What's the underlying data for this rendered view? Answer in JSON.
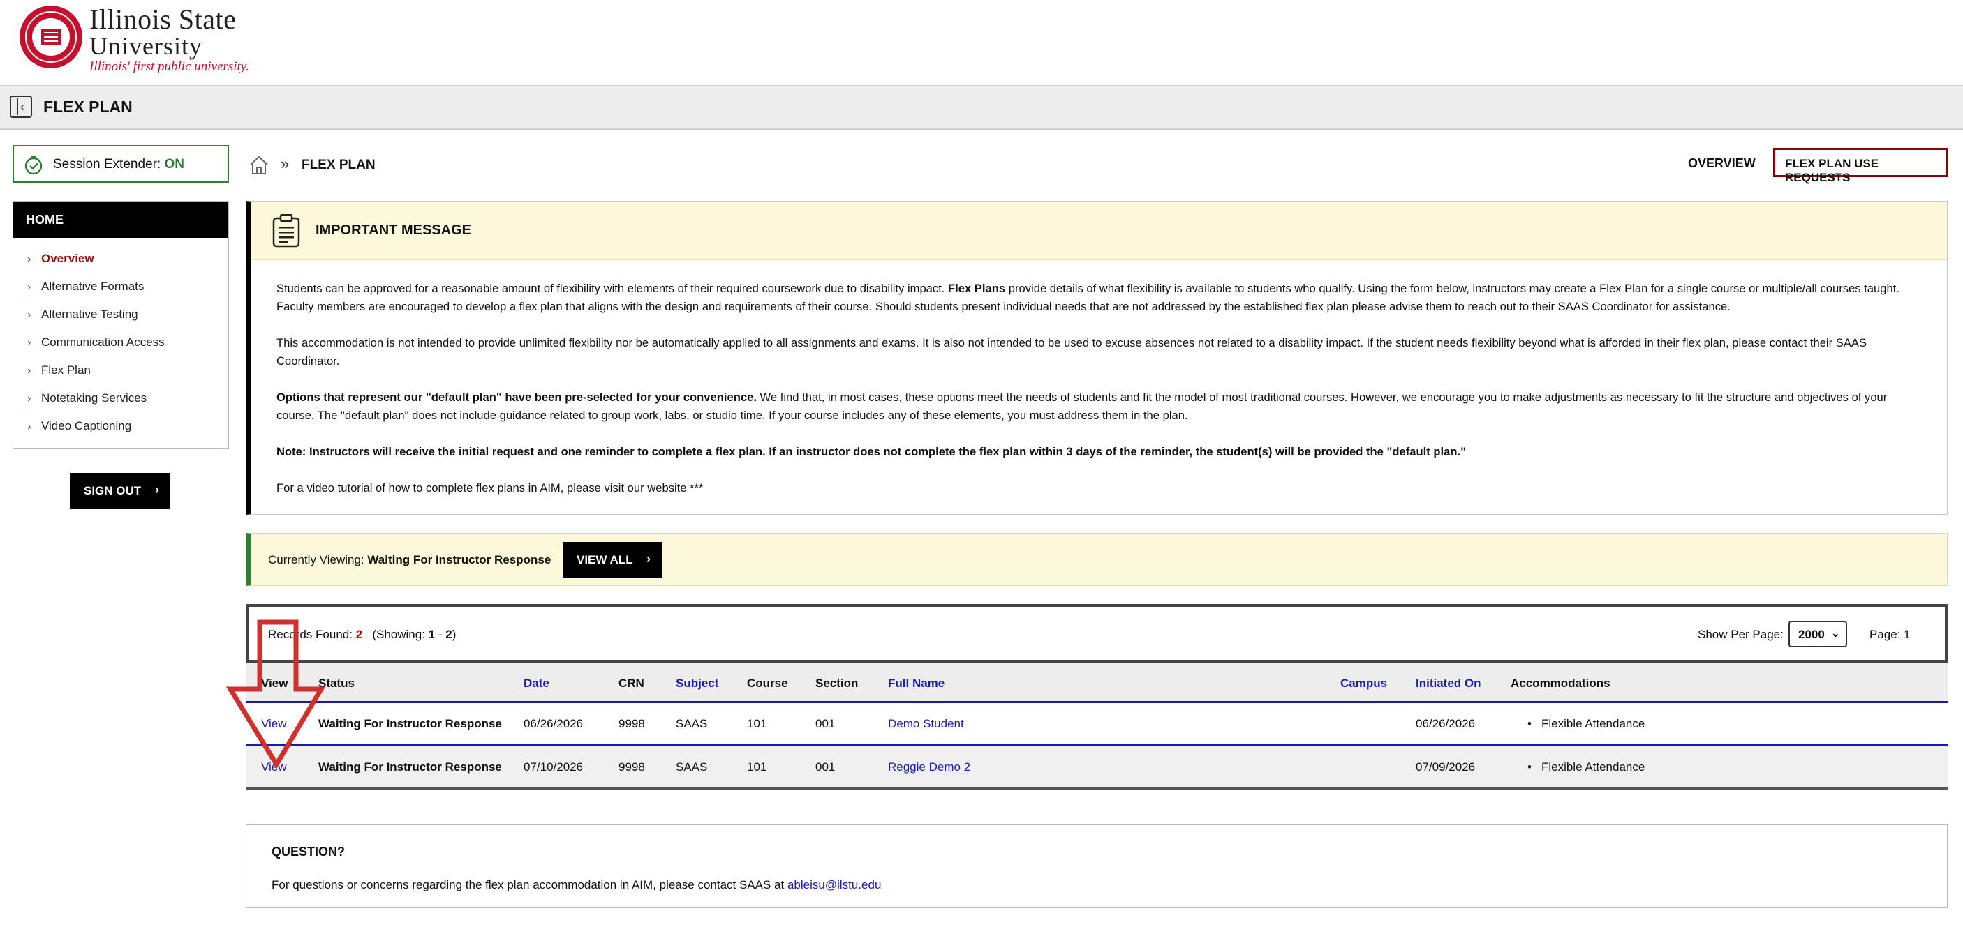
{
  "header": {
    "logo_line1": "Illinois State",
    "logo_line2": "University",
    "tagline": "Illinois' first public university."
  },
  "titlebar": {
    "title": "FLEX PLAN"
  },
  "session": {
    "label": "Session Extender:",
    "state": "ON"
  },
  "nav": {
    "heading": "HOME",
    "items": [
      {
        "label": "Overview"
      },
      {
        "label": "Alternative Formats"
      },
      {
        "label": "Alternative Testing"
      },
      {
        "label": "Communication Access"
      },
      {
        "label": "Flex Plan"
      },
      {
        "label": "Notetaking Services"
      },
      {
        "label": "Video Captioning"
      }
    ],
    "signout": "SIGN OUT"
  },
  "breadcrumb": {
    "current": "FLEX PLAN"
  },
  "top_links": {
    "overview": "OVERVIEW",
    "requests": "FLEX PLAN USE REQUESTS"
  },
  "message": {
    "title": "IMPORTANT MESSAGE",
    "p1_a": "Students can be approved for a reasonable amount of flexibility with elements of their required coursework due to disability impact. ",
    "p1_b": "Flex Plans",
    "p1_c": " provide details of what flexibility is available to students who qualify. Using the form below, instructors may create a Flex Plan for a single course or multiple/all courses taught. Faculty members are encouraged to develop a flex plan that aligns with the design and requirements of their course. Should students present individual needs that are not addressed by the established flex plan please advise them to reach out to their SAAS Coordinator for assistance.",
    "p2": "This accommodation is not intended to provide unlimited flexibility nor be automatically applied to all assignments and exams. It is also not intended to be used to excuse absences not related to a disability impact. If the student needs flexibility beyond what is afforded in their flex plan, please contact their SAAS Coordinator.",
    "p3_a": "Options that represent our \"default plan\" have been pre-selected for your convenience.",
    "p3_b": " We find that, in most cases, these options meet the needs of students and fit the model of most traditional courses. However, we encourage you to make adjustments as necessary to fit the structure and objectives of your course. The \"default plan\" does not include guidance related to group work, labs, or studio time. If your course includes any of these elements, you must address them in the plan.",
    "p4": "Note: Instructors will receive the initial request and one reminder to complete a flex plan. If an instructor does not complete the flex plan within 3 days of the reminder, the student(s) will be provided the \"default plan.\"",
    "p5": "For a video tutorial of how to complete flex plans in AIM, please visit our website ***"
  },
  "viewing": {
    "label": "Currently Viewing:",
    "value": "Waiting For Instructor Response",
    "button": "VIEW ALL"
  },
  "records": {
    "label": "Records Found:",
    "count": "2",
    "showing_prefix": "(Showing:",
    "showing_from": "1",
    "showing_sep": " - ",
    "showing_to": "2",
    "showing_suffix": ")",
    "per_page_label": "Show Per Page:",
    "per_page_value": "2000",
    "page_label": "Page: 1"
  },
  "table": {
    "headers": {
      "view": "View",
      "status": "Status",
      "date": "Date",
      "crn": "CRN",
      "subject": "Subject",
      "course": "Course",
      "section": "Section",
      "full_name": "Full Name",
      "campus": "Campus",
      "initiated_on": "Initiated On",
      "accommodations": "Accommodations"
    },
    "rows": [
      {
        "view": "View",
        "status": "Waiting For Instructor Response",
        "date": "06/26/2026",
        "crn": "9998",
        "subject": "SAAS",
        "course": "101",
        "section": "001",
        "full_name": "Demo Student",
        "campus": "",
        "initiated_on": "06/26/2026",
        "accommodations": "Flexible Attendance"
      },
      {
        "view": "View",
        "status": "Waiting For Instructor Response",
        "date": "07/10/2026",
        "crn": "9998",
        "subject": "SAAS",
        "course": "101",
        "section": "001",
        "full_name": "Reggie Demo 2",
        "campus": "",
        "initiated_on": "07/09/2026",
        "accommodations": "Flexible Attendance"
      }
    ]
  },
  "question": {
    "title": "QUESTION?",
    "text": "For questions or concerns regarding the flex plan accommodation in AIM, please contact SAAS at ",
    "email": "ableisu@ilstu.edu"
  },
  "colors": {
    "brand_red": "#c8102e",
    "success_green": "#2e7d32",
    "link_blue": "#1a1ab8",
    "annotation_red": "#d0312d"
  },
  "icons": [
    "seal-logo-icon",
    "sidebar-toggle-icon",
    "stopwatch-icon",
    "home-icon",
    "clipboard-icon",
    "chevron-right-icon",
    "chevron-down-icon",
    "annotation-arrow-icon"
  ]
}
